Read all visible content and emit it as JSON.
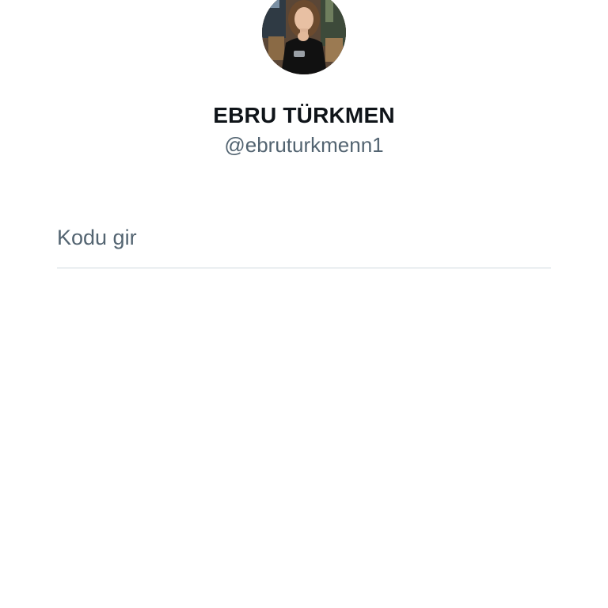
{
  "profile": {
    "display_name": "EBRU TÜRKMEN",
    "handle": "@ebruturkmenn1",
    "avatar_icon": "profile-photo"
  },
  "code_form": {
    "placeholder": "Kodu gir",
    "value": ""
  },
  "colors": {
    "background": "#ffffff",
    "name_text": "#0f1419",
    "secondary_text": "#536471",
    "divider": "#cfd9de"
  }
}
